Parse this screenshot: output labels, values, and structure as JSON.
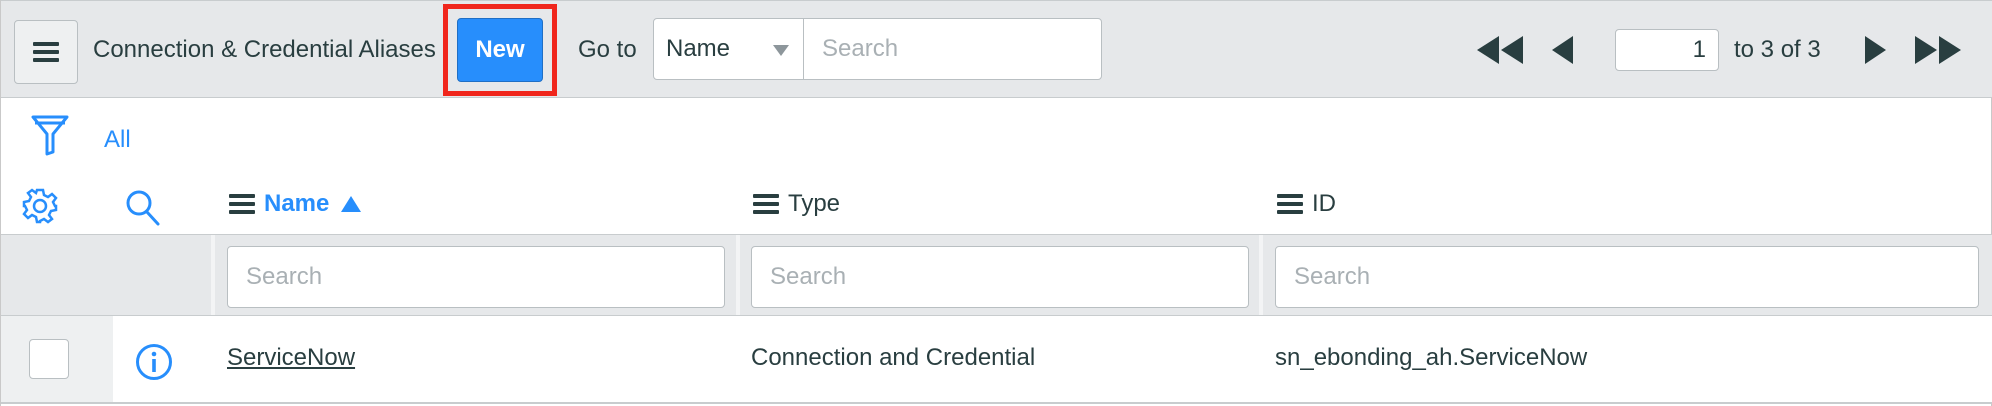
{
  "header": {
    "title": "Connection & Credential Aliases",
    "new_label": "New",
    "goto_label": "Go to",
    "goto_field": "Name",
    "goto_search_placeholder": "Search"
  },
  "pager": {
    "current_page": "1",
    "range_text": "to 3 of 3"
  },
  "filter": {
    "breadcrumb": "All"
  },
  "columns": [
    {
      "label": "Name",
      "sorted": "ascending"
    },
    {
      "label": "Type"
    },
    {
      "label": "ID"
    }
  ],
  "column_search_placeholder": "Search",
  "rows": [
    {
      "name": "ServiceNow",
      "type": "Connection and Credential",
      "id": "sn_ebonding_ah.ServiceNow"
    }
  ],
  "colors": {
    "accent": "#278efc",
    "highlight_box": "#f0261c",
    "header_bg": "#e6e8ea",
    "text": "#293e40"
  },
  "icons": [
    "menu-icon",
    "first-page-icon",
    "prev-page-icon",
    "next-page-icon",
    "last-page-icon",
    "filter-funnel-icon",
    "gear-icon",
    "search-icon",
    "column-menu-icon",
    "sort-ascending-icon",
    "info-icon"
  ]
}
